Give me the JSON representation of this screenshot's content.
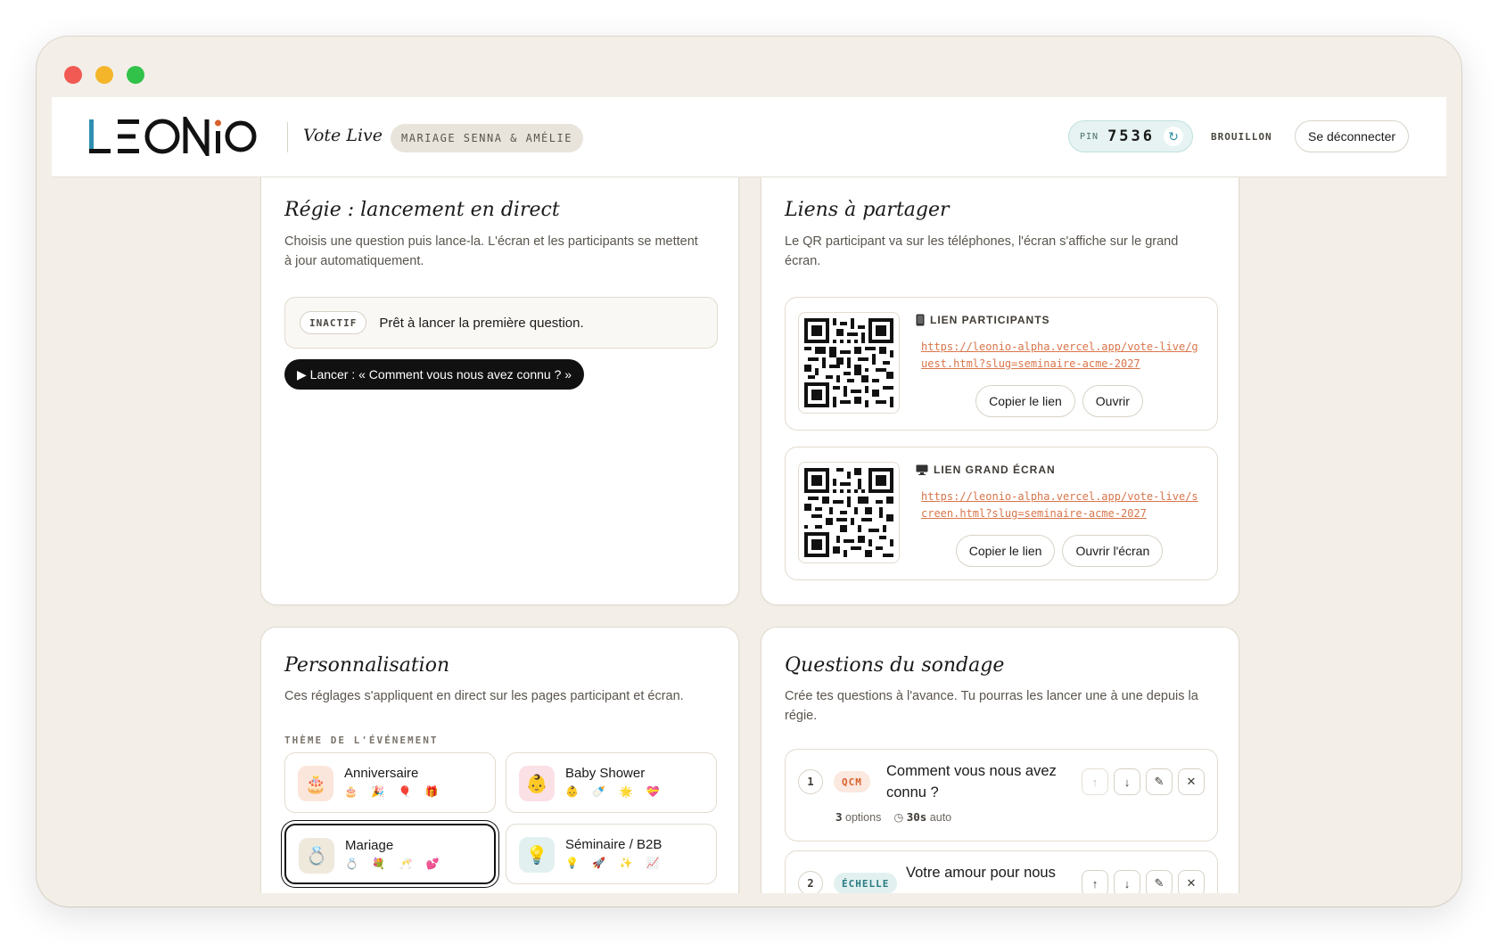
{
  "app": {
    "logo_text": "LEONiO",
    "product_name": "Vote Live",
    "event_name": "MARIAGE SENNA & AMÉLIE",
    "pin_label": "PIN",
    "pin_value": "7536",
    "status": "BROUILLON",
    "logout_label": "Se déconnecter"
  },
  "regie": {
    "title": "Régie : lancement en direct",
    "description": "Choisis une question puis lance-la. L'écran et les participants se mettent à jour automatiquement.",
    "state_badge": "INACTIF",
    "state_text": "Prêt à lancer la première question.",
    "launch_label": "▶ Lancer : « Comment vous nous avez connu ? »"
  },
  "liens": {
    "title": "Liens à partager",
    "description": "Le QR participant va sur les téléphones, l'écran s'affiche sur le grand écran.",
    "participants": {
      "icon": "phone-icon",
      "title": "LIEN PARTICIPANTS",
      "url": "https://leonio-alpha.vercel.app/vote-live/guest.html?slug=seminaire-acme-2027",
      "copy_label": "Copier le lien",
      "open_label": "Ouvrir"
    },
    "screen": {
      "icon": "monitor-icon",
      "title": "LIEN GRAND ÉCRAN",
      "url": "https://leonio-alpha.vercel.app/vote-live/screen.html?slug=seminaire-acme-2027",
      "copy_label": "Copier le lien",
      "open_label": "Ouvrir l'écran"
    }
  },
  "perso": {
    "title": "Personnalisation",
    "description": "Ces réglages s'appliquent en direct sur les pages participant et écran.",
    "theme_label": "THÈME DE L'ÉVÉNEMENT",
    "themes": [
      {
        "name": "Anniversaire",
        "icon": "🎂",
        "emojis": "🎂 🎉 🎈 🎁",
        "bg": "#fbe6dc",
        "selected": false
      },
      {
        "name": "Baby Shower",
        "icon": "👶",
        "emojis": "👶 🍼 🌟 💝",
        "bg": "#fbe0e6",
        "selected": false
      },
      {
        "name": "Mariage",
        "icon": "💍",
        "emojis": "💍 💐 🥂 💕",
        "bg": "#efe9dc",
        "selected": true
      },
      {
        "name": "Séminaire / B2B",
        "icon": "💡",
        "emojis": "💡 🚀 ✨ 📈",
        "bg": "#e2f1f0",
        "selected": false
      }
    ]
  },
  "questions": {
    "title": "Questions du sondage",
    "description": "Crée tes questions à l'avance. Tu pourras les lancer une à une depuis la régie.",
    "items": [
      {
        "num": "1",
        "type": "QCM",
        "text": "Comment vous nous avez connu ?",
        "options_count": "3",
        "options_label": "options",
        "duration": "30s",
        "duration_mode": "auto"
      },
      {
        "num": "2",
        "type": "ÉCHELLE",
        "text": "Votre amour pour nous"
      }
    ]
  }
}
